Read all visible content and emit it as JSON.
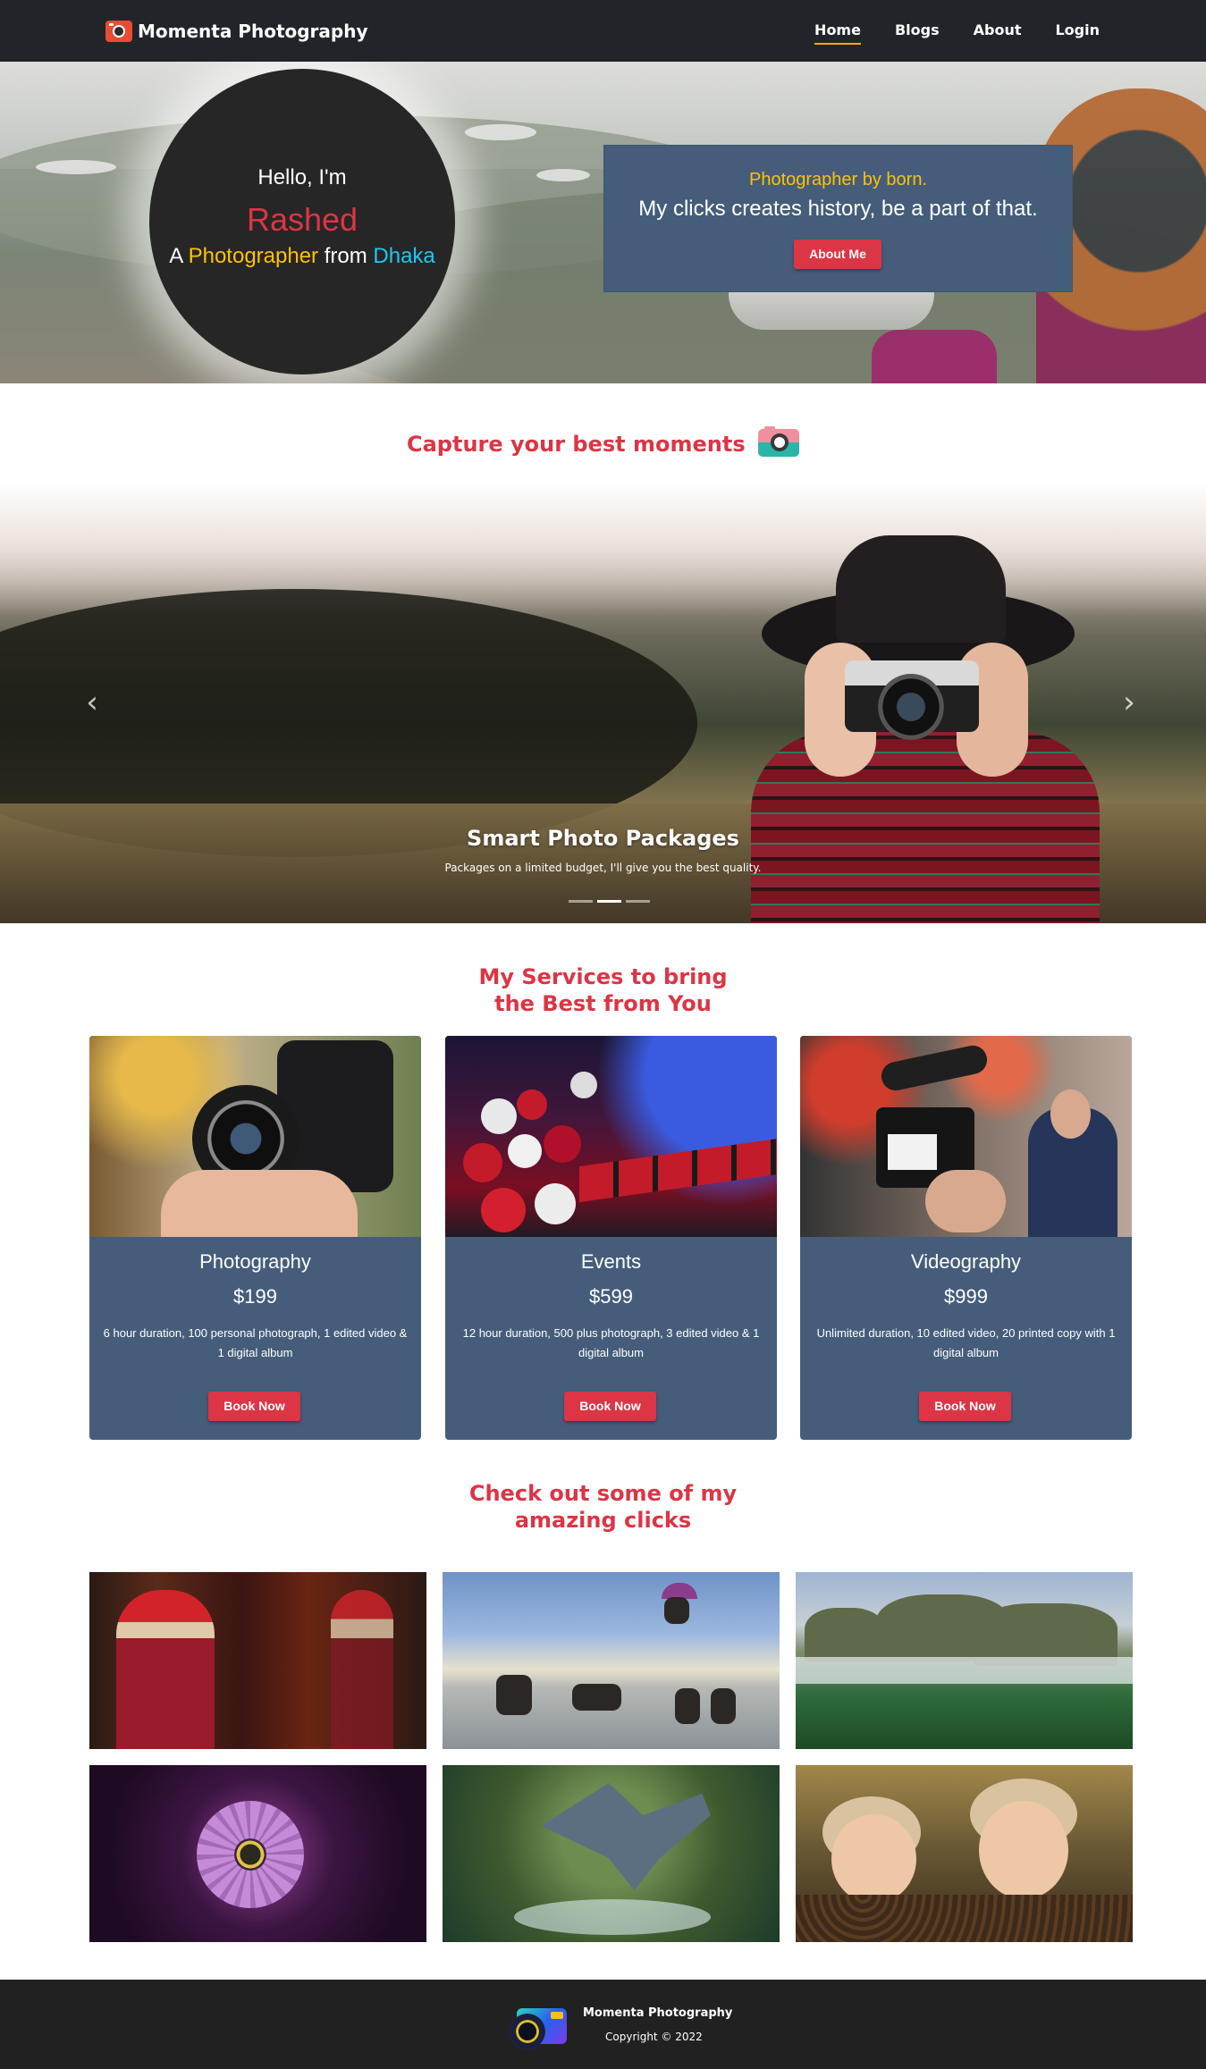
{
  "navbar": {
    "brand": "Momenta Photography",
    "links": [
      "Home",
      "Blogs",
      "About",
      "Login"
    ],
    "active": "Home"
  },
  "hero": {
    "hello": "Hello, I'm",
    "name": "Rashed",
    "line_prefix": "A",
    "line_profession": "Photographer",
    "line_middle": "from",
    "line_city": "Dhaka",
    "tagline": "Photographer by born.",
    "subtitle": "My clicks creates history, be a part of that.",
    "button": "About Me"
  },
  "capture_title": "Capture your best moments",
  "carousel": {
    "caption_title": "Smart Photo Packages",
    "caption_text": "Packages on a limited budget, I'll give you the best quality.",
    "prev_icon": "‹",
    "next_icon": "›",
    "slide_count": 3,
    "active_slide": 2
  },
  "services": {
    "title_line1": "My Services to bring",
    "title_line2": "the Best from You",
    "cards": [
      {
        "title": "Photography",
        "price": "$199",
        "desc": "6 hour duration, 100 personal photograph, 1 edited video & 1 digital album",
        "button": "Book Now"
      },
      {
        "title": "Events",
        "price": "$599",
        "desc": "12 hour duration, 500 plus photograph, 3 edited video & 1 digital album",
        "button": "Book Now"
      },
      {
        "title": "Videography",
        "price": "$999",
        "desc": "Unlimited duration, 10 edited video, 20 printed copy with 1 digital album",
        "button": "Book Now"
      }
    ]
  },
  "gallery": {
    "title_line1": "Check out some of my",
    "title_line2": "amazing clicks"
  },
  "footer": {
    "title": "Momenta Photography",
    "copyright": "Copyright © 2022"
  },
  "colors": {
    "navbar_bg": "#212529",
    "accent_red": "#dc3545",
    "accent_yellow": "#ffc107",
    "accent_cyan": "#1ec8f0",
    "card_bg": "#455d7a",
    "active_underline": "#f5a623"
  }
}
